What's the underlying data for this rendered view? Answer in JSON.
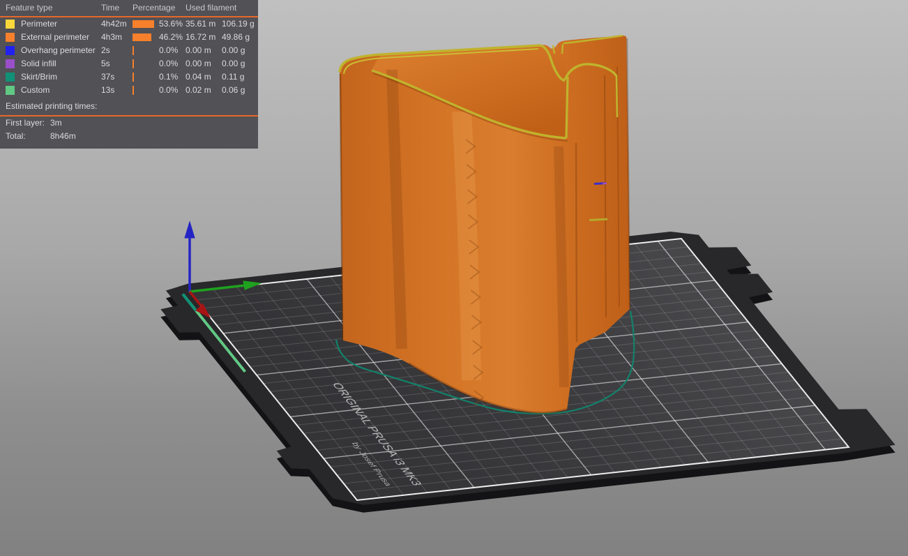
{
  "legend": {
    "headers": [
      "Feature type",
      "Time",
      "Percentage",
      "Used filament"
    ],
    "rows": [
      {
        "label": "Perimeter",
        "color": "#FCD73B",
        "time": "4h42m",
        "percentage": "53.6%",
        "pct": 53.6,
        "filament_m": "35.61 m",
        "filament_g": "106.19 g"
      },
      {
        "label": "External perimeter",
        "color": "#F6802B",
        "time": "4h3m",
        "percentage": "46.2%",
        "pct": 46.2,
        "filament_m": "16.72 m",
        "filament_g": "49.86 g"
      },
      {
        "label": "Overhang perimeter",
        "color": "#2121F0",
        "time": "2s",
        "percentage": "0.0%",
        "pct": 0.0,
        "filament_m": "0.00 m",
        "filament_g": "0.00 g"
      },
      {
        "label": "Solid infill",
        "color": "#9A4FC8",
        "time": "5s",
        "percentage": "0.0%",
        "pct": 0.0,
        "filament_m": "0.00 m",
        "filament_g": "0.00 g"
      },
      {
        "label": "Skirt/Brim",
        "color": "#109177",
        "time": "37s",
        "percentage": "0.1%",
        "pct": 0.1,
        "filament_m": "0.04 m",
        "filament_g": "0.11 g"
      },
      {
        "label": "Custom",
        "color": "#61C884",
        "time": "13s",
        "percentage": "0.0%",
        "pct": 0.0,
        "filament_m": "0.02 m",
        "filament_g": "0.06 g"
      }
    ],
    "estimated_title": "Estimated printing times:",
    "first_layer_label": "First layer:",
    "first_layer_value": "3m",
    "total_label": "Total:",
    "total_value": "8h46m",
    "accent_color": "#E8682A",
    "bar_color": "#F6802B",
    "max_pct": 53.6
  },
  "bed": {
    "label": "ORIGINAL PRUSA i3 MK3",
    "sublabel": "by Josef Prusa"
  },
  "axes": {
    "x_color": "#A81414",
    "y_color": "#1FA11F",
    "z_color": "#2424C4"
  },
  "model": {
    "body_color": "#CC6E28",
    "rim_color": "#BFB32D",
    "skirt_color": "#12826A",
    "custom_line_color": "#61C884",
    "overhang_mark_color": "#3A2ECC",
    "infill_mark_color": "#9A4FC8"
  }
}
